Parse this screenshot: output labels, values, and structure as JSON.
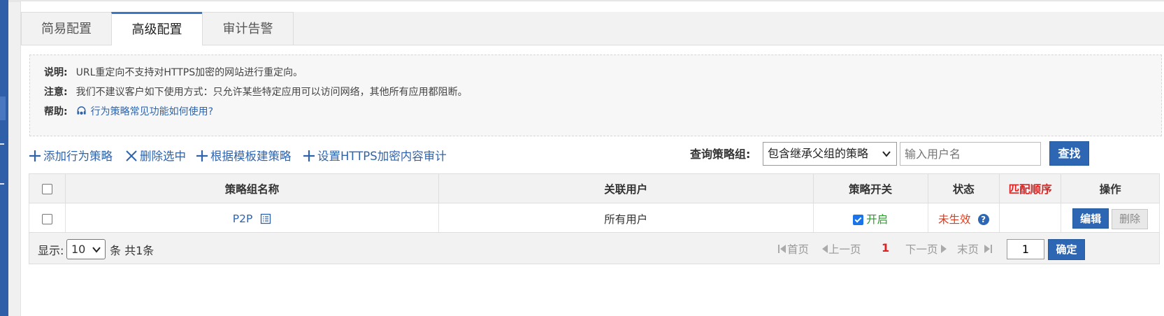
{
  "tabs": [
    "简易配置",
    "高级配置",
    "审计告警"
  ],
  "notice": {
    "desc_key": "说明:",
    "desc_text": "URL重定向不支持对HTTPS加密的网站进行重定向。",
    "warn_key": "注意:",
    "warn_text": "我们不建议客户如下使用方式：只允许某些特定应用可以访问网络，其他所有应用都阻断。",
    "help_key": "帮助:",
    "help_link": "行为策略常见功能如何使用?"
  },
  "toolbar": {
    "add": "添加行为策略",
    "delete": "删除选中",
    "template": "根据模板建策略",
    "https": "设置HTTPS加密内容审计",
    "query_label": "查询策略组:",
    "query_select": "包含继承父组的策略",
    "user_placeholder": "输入用户名",
    "search": "查找"
  },
  "table": {
    "headers": [
      "策略组名称",
      "关联用户",
      "策略开关",
      "状态",
      "匹配顺序",
      "操作"
    ],
    "rows": [
      {
        "name": "P2P",
        "users": "所有用户",
        "switch": "开启",
        "status": "未生效",
        "order": "",
        "edit": "编辑",
        "delete": "删除"
      }
    ]
  },
  "footer": {
    "show": "显示:",
    "page_size": "10",
    "count": "条 共1条",
    "first": "首页",
    "prev": "上一页",
    "current": "1",
    "next": "下一页",
    "last": "末页",
    "goto_value": "1",
    "confirm": "确定"
  },
  "colors": {
    "accent": "#2d67b4",
    "link": "#2f64ad",
    "danger": "#e02020",
    "success": "#2a9a2a"
  }
}
